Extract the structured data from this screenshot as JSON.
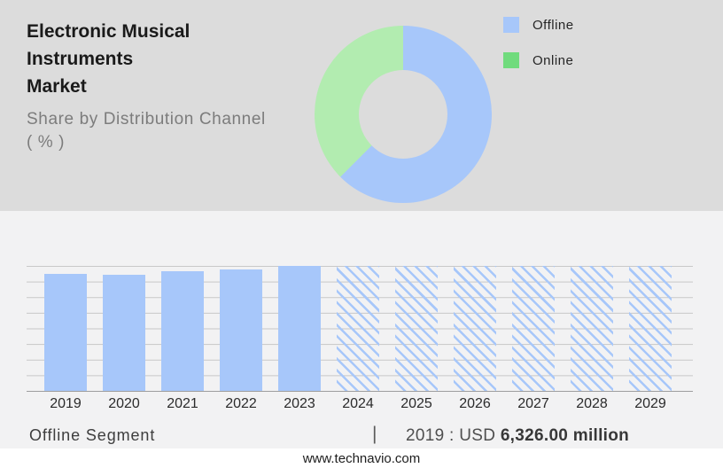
{
  "header": {
    "title_line1": "Electronic Musical Instruments",
    "title_line2": "Market",
    "subtitle_line1": "Share by Distribution Channel",
    "subtitle_line2": "( % )"
  },
  "legend": {
    "items": [
      {
        "label": "Offline",
        "color": "#a7c7fa"
      },
      {
        "label": "Online",
        "color": "#70db7d"
      }
    ]
  },
  "colors": {
    "top_bg": "#dcdcdc",
    "bottom_bg": "#f2f2f3",
    "footer_bg": "#ffffff",
    "bar_blue": "#a7c7fa",
    "donut_green": "#b2ecb0",
    "gridline": "#c7c7c7",
    "axis": "#9e9e9e"
  },
  "chart_data": [
    {
      "type": "pie",
      "donut": true,
      "title": "Share by Distribution Channel (%)",
      "labels": [
        "Offline",
        "Online"
      ],
      "values": [
        62.5,
        37.5
      ],
      "colors": [
        "#a7c7fa",
        "#b2ecb0"
      ],
      "legend_position": "right",
      "note": "slice values estimated from arc angles; no numeric labels shown"
    },
    {
      "type": "bar",
      "title": "Offline Segment market size by year",
      "unit": "USD million",
      "categories": [
        "2019",
        "2020",
        "2021",
        "2022",
        "2023",
        "2024",
        "2025",
        "2026",
        "2027",
        "2028",
        "2029"
      ],
      "values": [
        6326.0,
        6280,
        6440,
        6530,
        6740,
        null,
        null,
        null,
        null,
        null,
        null
      ],
      "values_note": "2019 labeled as USD 6,326.00 million; 2020-2023 estimated from bar heights; 2024-2029 are hatched forecast placeholders with no values shown",
      "height_frac": [
        0.939,
        0.932,
        0.955,
        0.969,
        1.0,
        1.0,
        1.0,
        1.0,
        1.0,
        1.0,
        1.0
      ],
      "forecast": [
        false,
        false,
        false,
        false,
        false,
        true,
        true,
        true,
        true,
        true,
        true
      ],
      "grid": true,
      "legend_position": "none",
      "annotation": "2019 : USD 6,326.00 million"
    }
  ],
  "bottom_row": {
    "segment_label": "Offline Segment",
    "separator": "|",
    "value_prefix": "2019 : USD ",
    "value_bold": "6,326.00 million"
  },
  "footer": {
    "website": "www.technavio.com"
  }
}
